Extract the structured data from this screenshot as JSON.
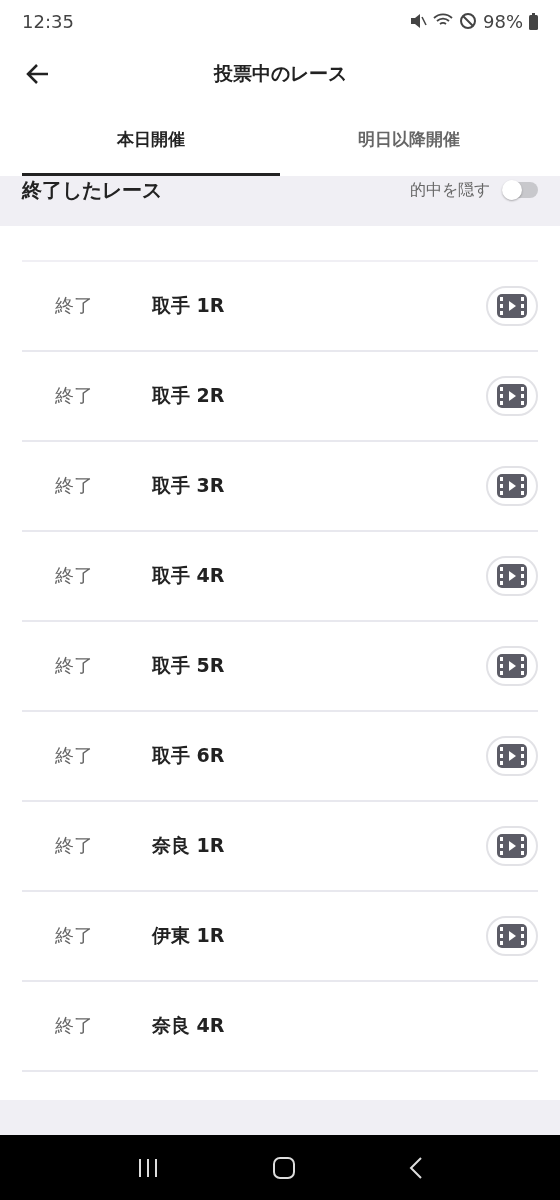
{
  "status_bar": {
    "time": "12:35",
    "battery": "98%"
  },
  "header": {
    "title": "投票中のレース"
  },
  "tabs": [
    {
      "label": "本日開催",
      "selected": true
    },
    {
      "label": "明日以降開催",
      "selected": false
    }
  ],
  "section": {
    "title": "終了したレース",
    "toggle_label": "的中を隠す",
    "toggle_on": false
  },
  "races": [
    {
      "status": "終了",
      "name": "取手 1R",
      "has_video": true
    },
    {
      "status": "終了",
      "name": "取手 2R",
      "has_video": true
    },
    {
      "status": "終了",
      "name": "取手 3R",
      "has_video": true
    },
    {
      "status": "終了",
      "name": "取手 4R",
      "has_video": true
    },
    {
      "status": "終了",
      "name": "取手 5R",
      "has_video": true
    },
    {
      "status": "終了",
      "name": "取手 6R",
      "has_video": true
    },
    {
      "status": "終了",
      "name": "奈良 1R",
      "has_video": true
    },
    {
      "status": "終了",
      "name": "伊東 1R",
      "has_video": true
    },
    {
      "status": "終了",
      "name": "奈良 4R",
      "has_video": false
    }
  ]
}
